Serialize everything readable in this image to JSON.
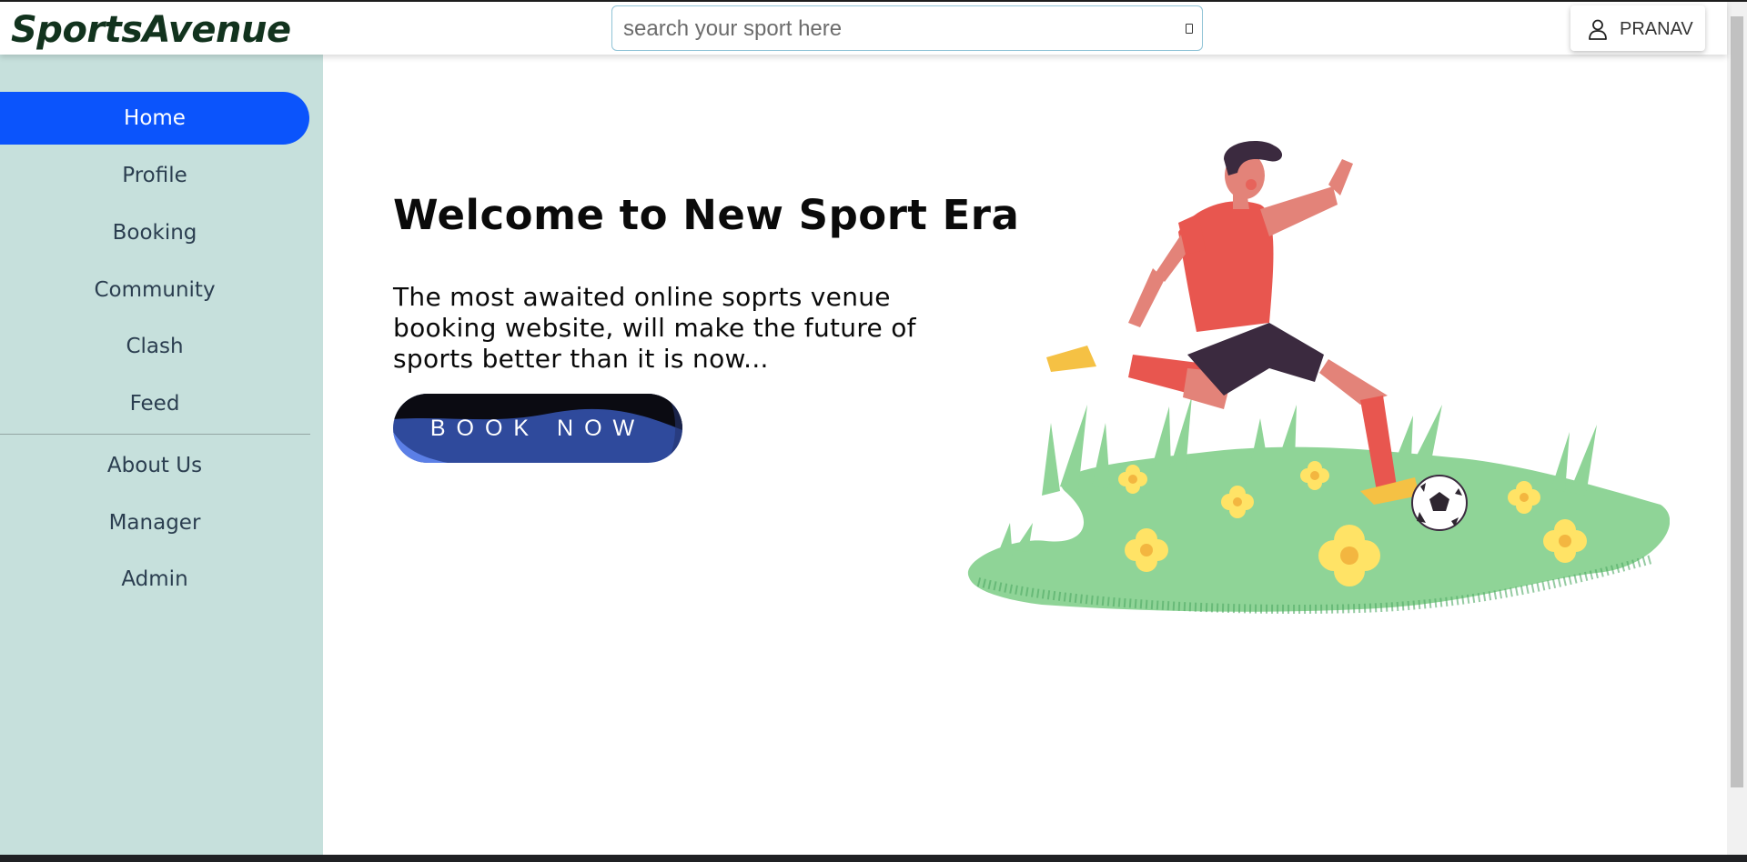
{
  "header": {
    "logo": "SportsAvenue",
    "search": {
      "placeholder": "search your sport here",
      "value": ""
    },
    "user": {
      "name": "PRANAV",
      "icon": "user-icon"
    }
  },
  "sidebar": {
    "items": [
      {
        "label": "Home",
        "active": true
      },
      {
        "label": "Profile"
      },
      {
        "label": "Booking"
      },
      {
        "label": "Community"
      },
      {
        "label": "Clash"
      },
      {
        "label": "Feed"
      }
    ],
    "secondary_items": [
      {
        "label": "About Us"
      },
      {
        "label": "Manager"
      },
      {
        "label": "Admin"
      }
    ]
  },
  "main": {
    "headline": "Welcome to New Sport Era",
    "subtext": "The most awaited online soprts venue booking website, will make the future of sports better than it is now...",
    "cta_label": "BOOK NOW",
    "illustration": "soccer-player-illustration"
  },
  "colors": {
    "accent": "#0b54fc",
    "sidebar_bg": "#c6e0dc",
    "button_bg": "#2f4a9c",
    "logo": "#12331e"
  }
}
